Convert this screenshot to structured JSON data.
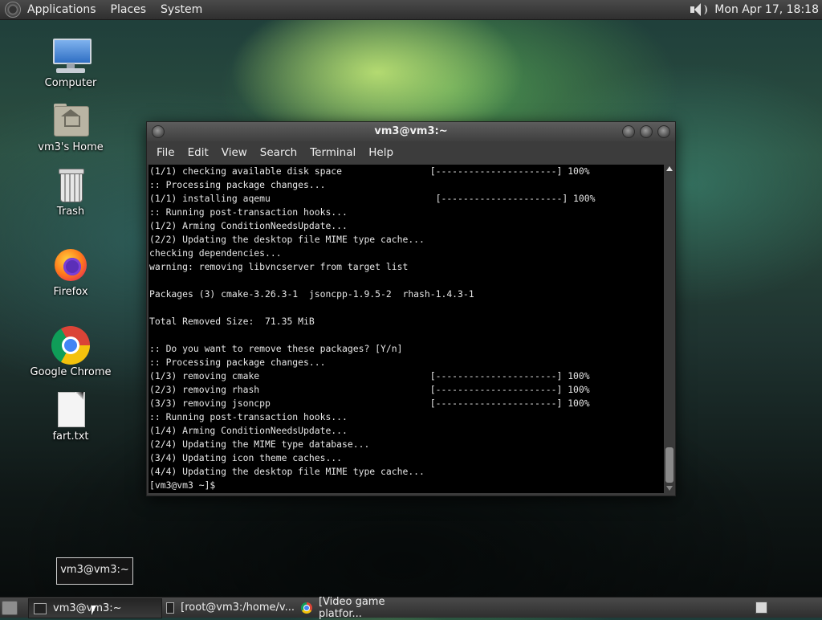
{
  "top_panel": {
    "menus": [
      "Applications",
      "Places",
      "System"
    ],
    "clock": "Mon Apr 17, 18:18",
    "icons": [
      "distro-logo-icon",
      "volume-icon"
    ]
  },
  "desktop_icons": [
    {
      "label": "Computer",
      "icon": "computer-icon"
    },
    {
      "label": "vm3's Home",
      "icon": "home-folder-icon"
    },
    {
      "label": "Trash",
      "icon": "trash-icon"
    },
    {
      "label": "Firefox",
      "icon": "firefox-icon"
    },
    {
      "label": "Google Chrome",
      "icon": "chrome-icon"
    },
    {
      "label": "fart.txt",
      "icon": "text-file-icon"
    }
  ],
  "terminal": {
    "title": "vm3@vm3:~",
    "menu": [
      "File",
      "Edit",
      "View",
      "Search",
      "Terminal",
      "Help"
    ],
    "lines": [
      "(1/1) checking available disk space                [----------------------] 100%",
      ":: Processing package changes...",
      "(1/1) installing aqemu                              [----------------------] 100%",
      ":: Running post-transaction hooks...",
      "(1/2) Arming ConditionNeedsUpdate...",
      "(2/2) Updating the desktop file MIME type cache...",
      "checking dependencies...",
      "warning: removing libvncserver from target list",
      "",
      "Packages (3) cmake-3.26.3-1  jsoncpp-1.9.5-2  rhash-1.4.3-1",
      "",
      "Total Removed Size:  71.35 MiB",
      "",
      ":: Do you want to remove these packages? [Y/n]",
      ":: Processing package changes...",
      "(1/3) removing cmake                               [----------------------] 100%",
      "(2/3) removing rhash                               [----------------------] 100%",
      "(3/3) removing jsoncpp                             [----------------------] 100%",
      ":: Running post-transaction hooks...",
      "(1/4) Arming ConditionNeedsUpdate...",
      "(2/4) Updating the MIME type database...",
      "(3/4) Updating icon theme caches...",
      "(4/4) Updating the desktop file MIME type cache...",
      "[vm3@vm3 ~]$ "
    ]
  },
  "tooltip": "vm3@vm3:~",
  "taskbar": {
    "tasks": [
      {
        "label": "vm3@vm3:~",
        "active": true,
        "icon": "terminal-icon"
      },
      {
        "label": "[root@vm3:/home/v...",
        "active": false,
        "icon": "terminal-icon"
      },
      {
        "label": "[Video game platfor...",
        "active": false,
        "icon": "chrome-icon"
      }
    ]
  }
}
